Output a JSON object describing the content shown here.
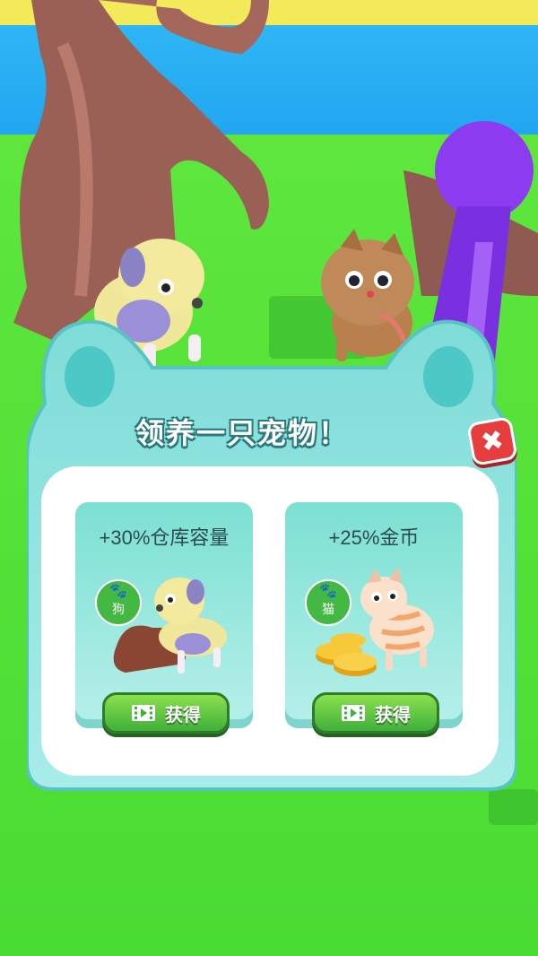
{
  "dialog": {
    "title": "领养一只宠物！",
    "close_symbol": "✖"
  },
  "cards": [
    {
      "title": "+30%仓库容量",
      "pet_type": "狗",
      "pet_icon": "paw-icon",
      "pet_name": "dog",
      "bonus_item": "sack",
      "button_label": "获得",
      "button_icon": "video-icon"
    },
    {
      "title": "+25%金币",
      "pet_type": "猫",
      "pet_icon": "paw-icon",
      "pet_name": "cat",
      "bonus_item": "gold-coins",
      "button_label": "获得",
      "button_icon": "video-icon"
    }
  ],
  "colors": {
    "panel": "#8fe3df",
    "panel_border": "#58c3c3",
    "button_green": "#4cbf3a",
    "close_red": "#e63e3e",
    "grass": "#4fe03a",
    "water": "#2fb6f5"
  }
}
